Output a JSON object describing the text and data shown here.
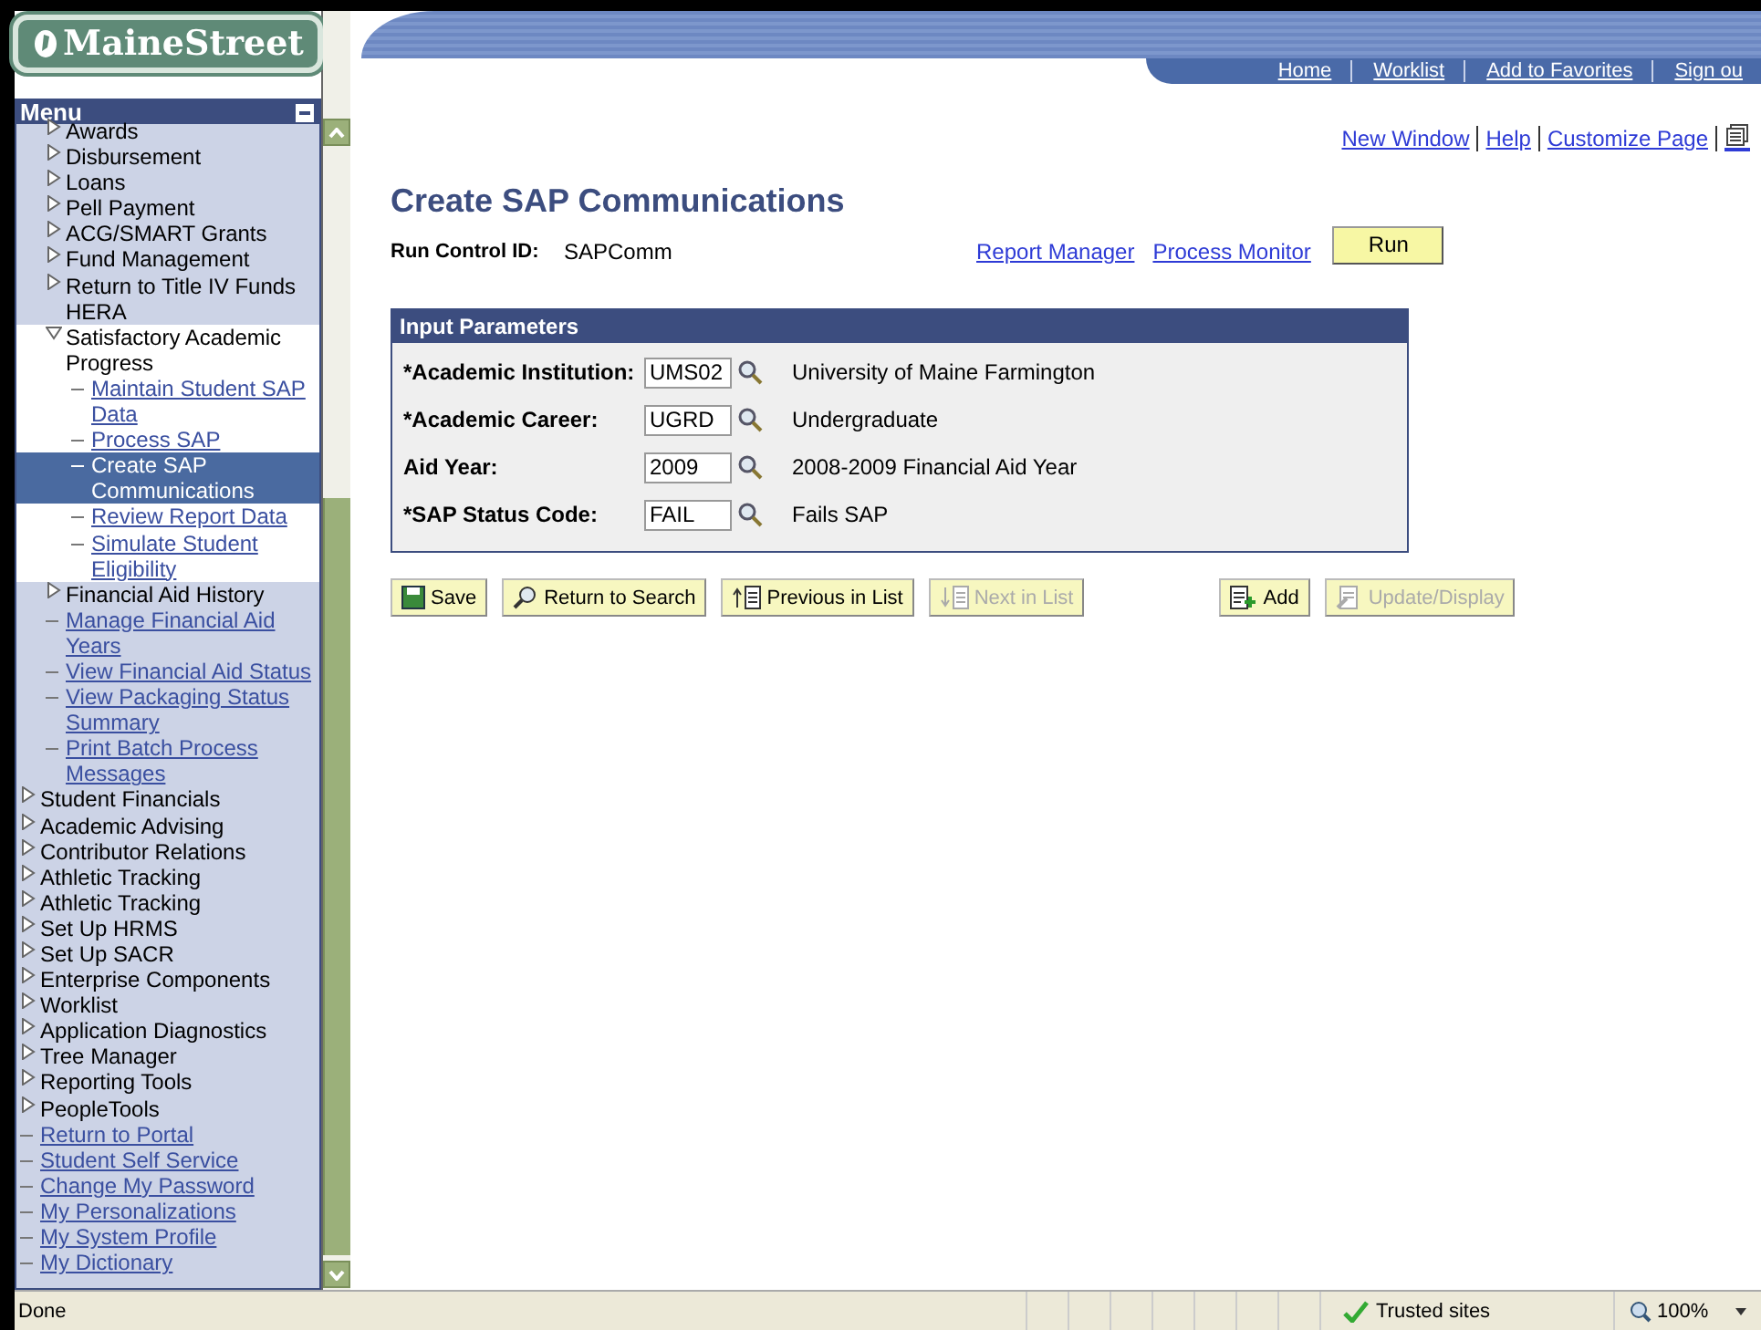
{
  "logo": {
    "text": "MaineStreet"
  },
  "nav_links": [
    "Home",
    "Worklist",
    "Add to Favorites",
    "Sign ou"
  ],
  "menu": {
    "title": "Menu",
    "items": [
      {
        "kind": "group",
        "children": [
          {
            "kind": "folder",
            "label": "Awards",
            "expanded": false
          },
          {
            "kind": "folder",
            "label": "Disbursement",
            "expanded": false
          },
          {
            "kind": "folder",
            "label": "Loans",
            "expanded": false
          },
          {
            "kind": "folder",
            "label": "Pell Payment",
            "expanded": false
          },
          {
            "kind": "folder",
            "label": "ACG/SMART Grants",
            "expanded": false
          },
          {
            "kind": "folder",
            "label": "Fund Management",
            "expanded": false
          },
          {
            "kind": "folder",
            "label": "Return to Title IV Funds HERA",
            "expanded": false
          },
          {
            "kind": "folder",
            "label": "Satisfactory Academic Progress",
            "expanded": true,
            "children": [
              {
                "kind": "link",
                "label": "Maintain Student SAP Data",
                "selected": false
              },
              {
                "kind": "link",
                "label": "Process SAP",
                "selected": false
              },
              {
                "kind": "link",
                "label": "Create SAP Communications",
                "selected": true
              },
              {
                "kind": "link",
                "label": "Review Report Data",
                "selected": false
              },
              {
                "kind": "link",
                "label": "Simulate Student Eligibility",
                "selected": false
              }
            ]
          },
          {
            "kind": "folder",
            "label": "Financial Aid History",
            "expanded": false
          },
          {
            "kind": "link",
            "label": "Manage Financial Aid Years",
            "selected": false
          },
          {
            "kind": "link",
            "label": "View Financial Aid Status",
            "selected": false
          },
          {
            "kind": "link",
            "label": "View Packaging Status Summary",
            "selected": false
          },
          {
            "kind": "link",
            "label": "Print Batch Process Messages",
            "selected": false
          }
        ]
      },
      {
        "kind": "folder",
        "label": "Student Financials",
        "expanded": false
      },
      {
        "kind": "folder",
        "label": "Academic Advising",
        "expanded": false
      },
      {
        "kind": "folder",
        "label": "Contributor Relations",
        "expanded": false
      },
      {
        "kind": "folder",
        "label": "Athletic Tracking",
        "expanded": false
      },
      {
        "kind": "folder",
        "label": "Athletic Tracking",
        "expanded": false
      },
      {
        "kind": "folder",
        "label": "Set Up HRMS",
        "expanded": false
      },
      {
        "kind": "folder",
        "label": "Set Up SACR",
        "expanded": false
      },
      {
        "kind": "folder",
        "label": "Enterprise Components",
        "expanded": false
      },
      {
        "kind": "folder",
        "label": "Worklist",
        "expanded": false
      },
      {
        "kind": "folder",
        "label": "Application Diagnostics",
        "expanded": false
      },
      {
        "kind": "folder",
        "label": "Tree Manager",
        "expanded": false
      },
      {
        "kind": "folder",
        "label": "Reporting Tools",
        "expanded": false
      },
      {
        "kind": "folder",
        "label": "PeopleTools",
        "expanded": false
      },
      {
        "kind": "link",
        "label": "Return to Portal",
        "selected": false
      },
      {
        "kind": "link",
        "label": "Student Self Service",
        "selected": false
      },
      {
        "kind": "link",
        "label": "Change My Password",
        "selected": false
      },
      {
        "kind": "link",
        "label": "My Personalizations",
        "selected": false
      },
      {
        "kind": "link",
        "label": "My System Profile",
        "selected": false
      },
      {
        "kind": "link",
        "label": "My Dictionary",
        "selected": false
      }
    ]
  },
  "page_links": [
    "New Window",
    "Help",
    "Customize Page"
  ],
  "page_title": "Create SAP Communications",
  "run_control": {
    "label": "Run Control ID:",
    "value": "SAPComm",
    "links": [
      "Report Manager",
      "Process Monitor"
    ],
    "button": "Run"
  },
  "input_parameters": {
    "title": "Input Parameters",
    "fields": [
      {
        "label": "*Academic Institution:",
        "value": "UMS02",
        "description": "University of Maine Farmington"
      },
      {
        "label": "*Academic Career:",
        "value": "UGRD",
        "description": "Undergraduate"
      },
      {
        "label": "Aid Year:",
        "value": "2009",
        "description": "2008-2009 Financial Aid Year"
      },
      {
        "label": "*SAP Status Code:",
        "value": "FAIL",
        "description": "Fails SAP"
      }
    ]
  },
  "toolbar": [
    {
      "kind": "save",
      "label": "Save",
      "disabled": false
    },
    {
      "kind": "search",
      "label": "Return to Search",
      "disabled": false
    },
    {
      "kind": "previous",
      "label": "Previous in List",
      "disabled": false
    },
    {
      "kind": "next",
      "label": "Next in List",
      "disabled": true
    },
    {
      "kind": "add",
      "label": "Add",
      "disabled": false
    },
    {
      "kind": "update",
      "label": "Update/Display",
      "disabled": true
    }
  ],
  "status_bar": {
    "text": "Done",
    "zone": "Trusted sites",
    "zoom": "100%"
  }
}
